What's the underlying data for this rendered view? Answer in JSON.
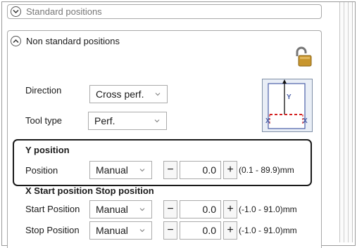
{
  "standard_section": {
    "title": "Standard positions",
    "icon": "chevron-down-icon"
  },
  "nonstandard_section": {
    "title": "Non standard positions",
    "icon": "chevron-up-icon"
  },
  "lock": {
    "icon": "unlocked-padlock-icon"
  },
  "direction": {
    "label": "Direction",
    "value": "Cross perf."
  },
  "tool_type": {
    "label": "Tool type",
    "value": "Perf."
  },
  "preview": {
    "icon": "cross-perf-direction-preview-icon",
    "y_label": "Y",
    "x_label_left": "X",
    "x_label_right": "X"
  },
  "y_position": {
    "heading": "Y position",
    "rows": [
      {
        "label": "Position",
        "mode": "Manual",
        "minus": "−",
        "value": "0.0",
        "plus": "+",
        "range": "(0.1 - 89.9)mm"
      }
    ]
  },
  "x_position": {
    "heading": "X Start position Stop position",
    "rows": [
      {
        "label": "Start Position",
        "mode": "Manual",
        "minus": "−",
        "value": "0.0",
        "plus": "+",
        "range": "(-1.0 - 91.0)mm"
      },
      {
        "label": "Stop Position",
        "mode": "Manual",
        "minus": "−",
        "value": "0.0",
        "plus": "+",
        "range": "(-1.0 - 91.0)mm"
      }
    ]
  },
  "colors": {
    "accent_red": "#d42020",
    "lock_gold": "#c8962e",
    "preview_blue": "#4b5fa8"
  }
}
